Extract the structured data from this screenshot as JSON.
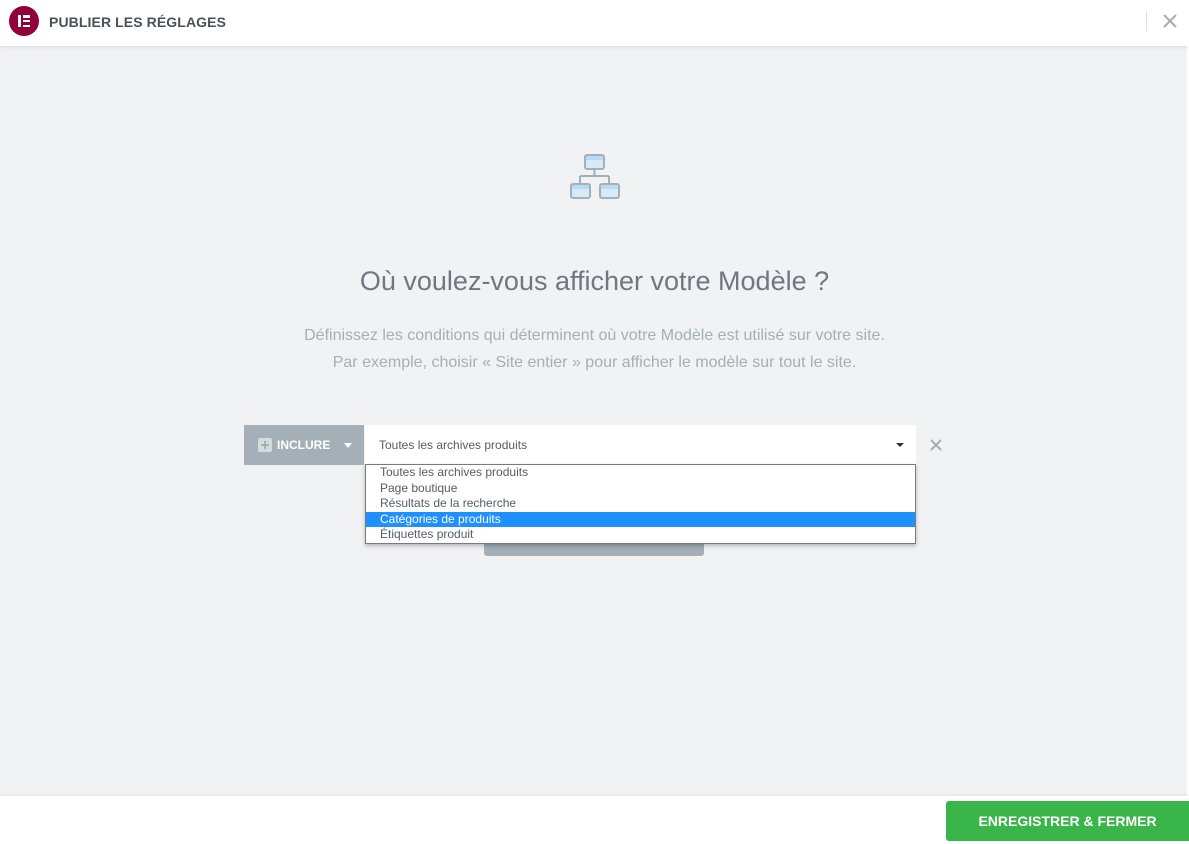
{
  "header": {
    "title": "PUBLIER LES RÉGLAGES",
    "logo_icon": "elementor-logo-icon",
    "close_icon": "close-icon"
  },
  "main": {
    "illustration_icon": "sitemap-icon",
    "question": "Où voulez-vous afficher votre Modèle ?",
    "description_line1": "Définissez les conditions qui déterminent où votre Modèle est utilisé sur votre site.",
    "description_line2": "Par exemple, choisir « Site entier » pour afficher le modèle sur tout le site."
  },
  "condition": {
    "type_label": "INCLURE",
    "selected_value": "Toutes les archives produits",
    "options": [
      "Toutes les archives produits",
      "Page boutique",
      "Résultats de la recherche",
      "Catégories de produits",
      "Étiquettes produit"
    ],
    "highlighted_option": "Catégories de produits"
  },
  "footer": {
    "save_label": "ENREGISTRER & FERMER"
  },
  "colors": {
    "brand": "#92003b",
    "save_button": "#39b54a",
    "highlight": "#1e90ff",
    "background": "#f1f2f3"
  }
}
